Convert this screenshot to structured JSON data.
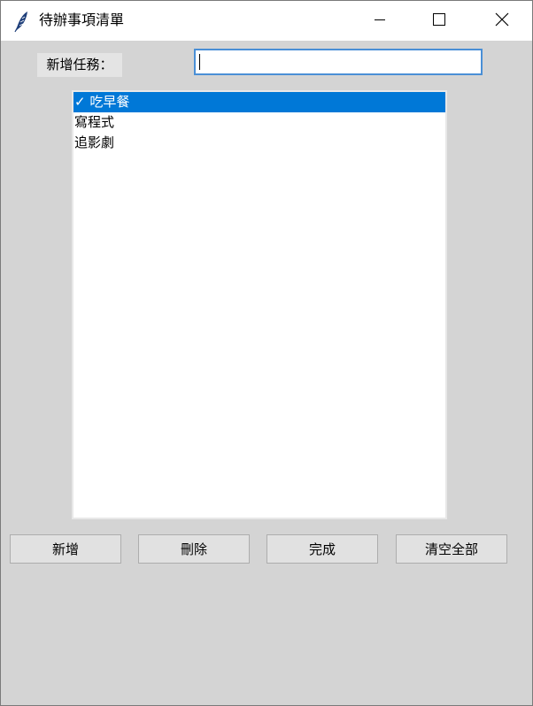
{
  "window": {
    "title": "待辦事項清單",
    "icon": "feather-icon",
    "controls": [
      "minimize-icon",
      "maximize-icon",
      "close-icon"
    ]
  },
  "form": {
    "label": "新增任務：",
    "input_value": ""
  },
  "tasks": [
    {
      "text": "✓ 吃早餐",
      "selected": true
    },
    {
      "text": "寫程式",
      "selected": false
    },
    {
      "text": "追影劇",
      "selected": false
    }
  ],
  "buttons": {
    "add": "新增",
    "delete": "刪除",
    "done": "完成",
    "clear": "清空全部"
  },
  "colors": {
    "selection": "#0078d7",
    "input_focus_border": "#4a8fd6",
    "background": "#d4d4d4"
  }
}
